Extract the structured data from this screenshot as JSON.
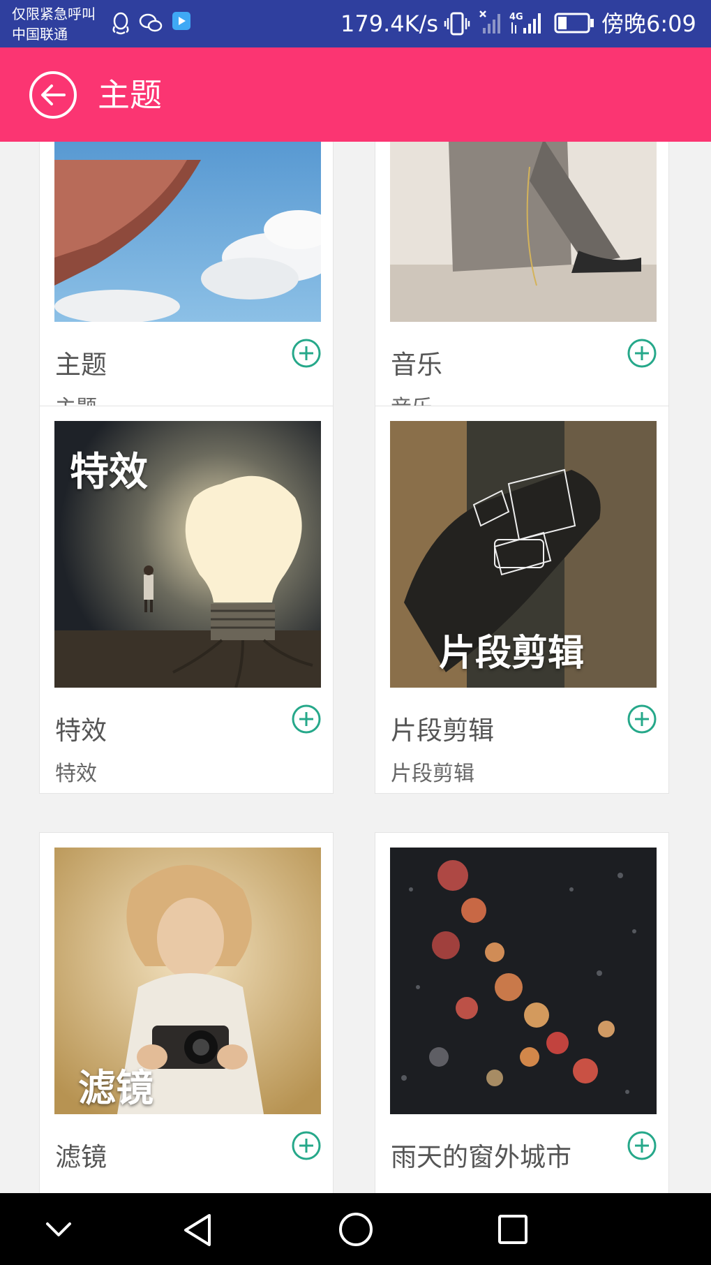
{
  "status_bar": {
    "carrier_line1": "仅限紧急呼叫",
    "carrier_line2": "中国联通",
    "speed": "179.4K/s",
    "time": "傍晚6:09",
    "icons": [
      "qq-icon",
      "wechat-icon",
      "video-icon",
      "vibrate-icon",
      "signal-off-icon",
      "4g-signal-icon",
      "battery-icon"
    ]
  },
  "app_bar": {
    "title": "主题",
    "back_icon": "back-arrow-icon",
    "color": "#fb3572"
  },
  "cards": [
    {
      "title": "主题",
      "subtitle": "主题",
      "image": "sky-hand-photo",
      "overlay": ""
    },
    {
      "title": "音乐",
      "subtitle": "音乐",
      "image": "sneakers-photo",
      "overlay": ""
    },
    {
      "title": "特效",
      "subtitle": "特效",
      "image": "lightbulb-photo",
      "overlay": "特效"
    },
    {
      "title": "片段剪辑",
      "subtitle": "片段剪辑",
      "image": "film-hand-photo",
      "overlay": "片段剪辑"
    },
    {
      "title": "滤镜",
      "subtitle": "",
      "image": "camera-girl-photo",
      "overlay": "滤镜"
    },
    {
      "title": "雨天的窗外城市",
      "subtitle": "",
      "image": "rainy-window-photo",
      "overlay": ""
    }
  ],
  "accent_color": "#26a88a",
  "nav_bar": {
    "buttons": [
      "collapse-icon",
      "back-icon",
      "home-icon",
      "recents-icon"
    ]
  }
}
